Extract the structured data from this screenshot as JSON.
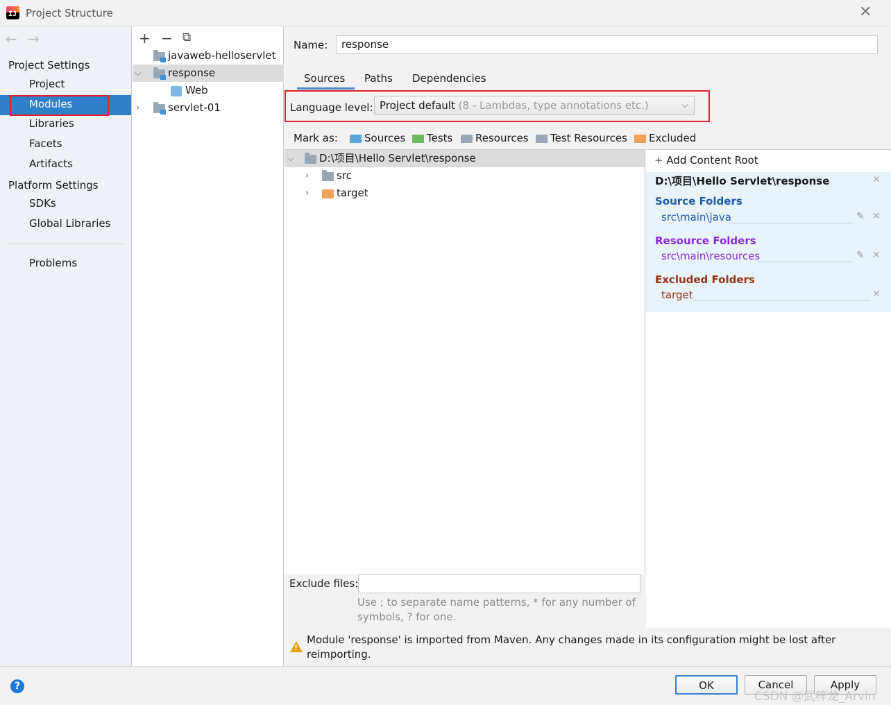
{
  "window": {
    "title": "Project Structure",
    "close_icon": "close-icon"
  },
  "nav": {
    "back": "←",
    "forward": "→",
    "project_settings": "Project Settings",
    "project_items": [
      "Project",
      "Modules",
      "Libraries",
      "Facets",
      "Artifacts"
    ],
    "platform_settings": "Platform Settings",
    "platform_items": [
      "SDKs",
      "Global Libraries"
    ],
    "problems": "Problems",
    "selected": "Modules",
    "selected_color": "#2f7fc9"
  },
  "tree": {
    "toolbar": {
      "add": "+",
      "remove": "−",
      "copy": "⧉"
    },
    "modules": [
      "javaweb-helloservlet",
      "response",
      "Web",
      "servlet-01"
    ]
  },
  "module": {
    "name_label": "Name:",
    "name_value": "response",
    "tabs": [
      "Sources",
      "Paths",
      "Dependencies"
    ],
    "active_tab": "Sources",
    "language_level_label": "Language level:",
    "language_level_value": "Project default",
    "language_level_hint": "(8 - Lambdas, type annotations etc.)",
    "mark_as_label": "Mark as:",
    "mark_as": [
      "Sources",
      "Tests",
      "Resources",
      "Test Resources",
      "Excluded"
    ],
    "mark_colors": [
      "#5aa6d9",
      "#6fb85b",
      "#9aa7b4",
      "#9aa7b4",
      "#f0a15a"
    ],
    "content_tree": [
      "D:\\项目\\Hello Servlet\\response",
      "src",
      "target"
    ],
    "roots": {
      "add_content_root": "Add Content Root",
      "root_path": "D:\\项目\\Hello Servlet\\response",
      "source_folders_title": "Source Folders",
      "source_folders": [
        "src\\main\\java"
      ],
      "resource_folders_title": "Resource Folders",
      "resource_folders": [
        "src\\main\\resources"
      ],
      "excluded_folders_title": "Excluded Folders",
      "excluded_folders": [
        "target"
      ],
      "source_color": "#1f5aa6",
      "resource_color": "#8a2be2",
      "excluded_color": "#9b3415"
    },
    "exclude_files_label": "Exclude files:",
    "exclude_files_value": "",
    "exclude_hint": "Use ; to separate name patterns, * for any number of symbols, ? for one.",
    "warning": "Module 'response' is imported from Maven. Any changes made in its configuration might be lost after reimporting."
  },
  "footer": {
    "help": "?",
    "ok": "OK",
    "cancel": "Cancel",
    "apply": "Apply",
    "watermark": "CSDN @武梓龙_Arvin"
  }
}
